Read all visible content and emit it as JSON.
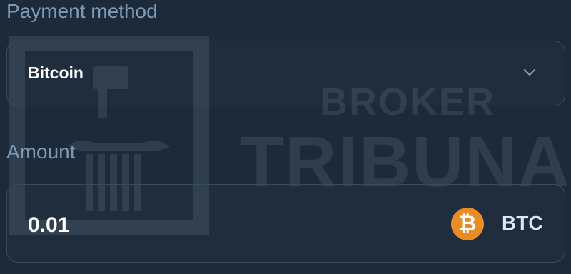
{
  "payment_method": {
    "label": "Payment method",
    "selected_value": "Bitcoin",
    "dropdown_icon": "chevron-down-icon"
  },
  "amount": {
    "label": "Amount",
    "value": "0.01",
    "currency_code": "BTC",
    "currency_icon": "bitcoin-icon",
    "currency_icon_glyph": "₿",
    "currency_icon_color": "#e88d24"
  },
  "watermark": {
    "line1": "BROKER",
    "line2": "TRIBUNAL"
  },
  "colors": {
    "background": "#1c2a3a",
    "label": "#7e99b6",
    "field_border": "#3a4b5d",
    "value_text": "#ffffff"
  }
}
